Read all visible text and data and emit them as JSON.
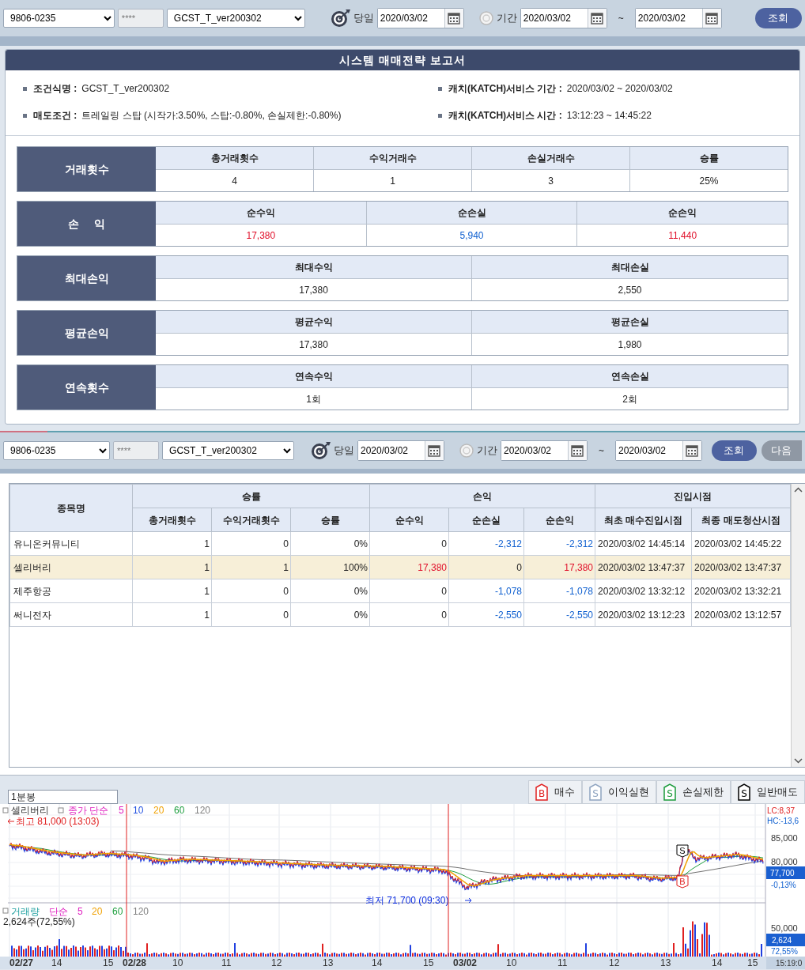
{
  "toolbars": [
    {
      "account": "9806-0235",
      "password": "****",
      "strategy": "GCST_T_ver200302",
      "modes": [
        {
          "label": "당일",
          "selected": true
        },
        {
          "label": "기간",
          "selected": false
        }
      ],
      "today_date": "2020/03/02",
      "period_from": "2020/03/02",
      "range_sep": "~",
      "period_to": "2020/03/02",
      "search_button": "조회"
    },
    {
      "account": "9806-0235",
      "password": "****",
      "strategy": "GCST_T_ver200302",
      "modes": [
        {
          "label": "당일",
          "selected": true
        },
        {
          "label": "기간",
          "selected": false
        }
      ],
      "today_date": "2020/03/02",
      "period_from": "2020/03/02",
      "range_sep": "~",
      "period_to": "2020/03/02",
      "search_button": "조회",
      "next_button": {
        "label": "다음",
        "disabled": true
      }
    }
  ],
  "report": {
    "title": "시스템 매매전략 보고서",
    "info": [
      {
        "label": "조건식명 :",
        "value": "GCST_T_ver200302"
      },
      {
        "label": "캐치(KATCH)서비스 기간 :",
        "value": "2020/03/02 ~ 2020/03/02"
      },
      {
        "label": "매도조건 :",
        "value": "트레일링 스탑 (시작가:3.50%, 스탑:-0.80%, 손실제한:-0.80%)"
      },
      {
        "label": "캐치(KATCH)서비스 시간 :",
        "value": "13:12:23 ~ 14:45:22"
      }
    ],
    "groups": [
      {
        "label": "거래횟수",
        "columns": [
          {
            "header": "총거래횟수",
            "value": "4",
            "color": "#222222"
          },
          {
            "header": "수익거래수",
            "value": "1",
            "color": "#222222"
          },
          {
            "header": "손실거래수",
            "value": "3",
            "color": "#222222"
          },
          {
            "header": "승률",
            "value": "25%",
            "color": "#222222"
          }
        ]
      },
      {
        "label": "손     익",
        "columns": [
          {
            "header": "순수익",
            "value": "17,380",
            "color": "#e0102a"
          },
          {
            "header": "순손실",
            "value": "5,940",
            "color": "#1060d0"
          },
          {
            "header": "순손익",
            "value": "11,440",
            "color": "#e0102a"
          }
        ]
      },
      {
        "label": "최대손익",
        "columns": [
          {
            "header": "최대수익",
            "value": "17,380",
            "color": "#222222"
          },
          {
            "header": "최대손실",
            "value": "2,550",
            "color": "#222222"
          }
        ]
      },
      {
        "label": "평균손익",
        "columns": [
          {
            "header": "평균수익",
            "value": "17,380",
            "color": "#222222"
          },
          {
            "header": "평균손실",
            "value": "1,980",
            "color": "#222222"
          }
        ]
      },
      {
        "label": "연속횟수",
        "columns": [
          {
            "header": "연속수익",
            "value": "1회",
            "color": "#222222"
          },
          {
            "header": "연속손실",
            "value": "2회",
            "color": "#222222"
          }
        ]
      }
    ]
  },
  "table": {
    "name_column": "종목명",
    "groups": [
      {
        "label": "승률",
        "columns": [
          "총거래횟수",
          "수익거래횟수",
          "승률"
        ]
      },
      {
        "label": "손익",
        "columns": [
          "순수익",
          "순손실",
          "순손익"
        ]
      },
      {
        "label": "진입시점",
        "columns": [
          "최초 매수진입시점",
          "최종 매도청산시점"
        ]
      }
    ],
    "rows": [
      {
        "name": "유니온커뮤니티",
        "selected": false,
        "cells": [
          {
            "text": "1"
          },
          {
            "text": "0"
          },
          {
            "text": "0%"
          },
          {
            "text": "0"
          },
          {
            "text": "-2,312",
            "color": "#1060d0"
          },
          {
            "text": "-2,312",
            "color": "#1060d0"
          },
          {
            "text": "2020/03/02 14:45:14"
          },
          {
            "text": "2020/03/02 14:45:22"
          }
        ]
      },
      {
        "name": "셀리버리",
        "selected": true,
        "cells": [
          {
            "text": "1"
          },
          {
            "text": "1"
          },
          {
            "text": "100%"
          },
          {
            "text": "17,380",
            "color": "#e0102a"
          },
          {
            "text": "0"
          },
          {
            "text": "17,380",
            "color": "#e0102a"
          },
          {
            "text": "2020/03/02 13:47:37"
          },
          {
            "text": "2020/03/02 13:47:37"
          }
        ]
      },
      {
        "name": "제주항공",
        "selected": false,
        "cells": [
          {
            "text": "1"
          },
          {
            "text": "0"
          },
          {
            "text": "0%"
          },
          {
            "text": "0"
          },
          {
            "text": "-1,078",
            "color": "#1060d0"
          },
          {
            "text": "-1,078",
            "color": "#1060d0"
          },
          {
            "text": "2020/03/02 13:32:12"
          },
          {
            "text": "2020/03/02 13:32:21"
          }
        ]
      },
      {
        "name": "써니전자",
        "selected": false,
        "cells": [
          {
            "text": "1"
          },
          {
            "text": "0"
          },
          {
            "text": "0%"
          },
          {
            "text": "0"
          },
          {
            "text": "-2,550",
            "color": "#1060d0"
          },
          {
            "text": "-2,550",
            "color": "#1060d0"
          },
          {
            "text": "2020/03/02 13:12:23"
          },
          {
            "text": "2020/03/02 13:12:57"
          }
        ]
      }
    ]
  },
  "chart": {
    "timeframe": "1분봉",
    "legend": [
      {
        "letter": "B",
        "label": "매수",
        "color": "#e02020"
      },
      {
        "letter": "S",
        "label": "이익실현",
        "color": "#8fa4c0"
      },
      {
        "letter": "S",
        "label": "손실제한",
        "color": "#1a9a3a"
      },
      {
        "letter": "S",
        "label": "일반매도",
        "color": "#000000"
      }
    ],
    "symbol": "셀리버리",
    "price_series": "종가 단순",
    "price_periods": [
      {
        "text": "5",
        "color": "#e020c0"
      },
      {
        "text": "10",
        "color": "#2050e0"
      },
      {
        "text": "20",
        "color": "#f0a000"
      },
      {
        "text": "60",
        "color": "#20a040"
      },
      {
        "text": "120",
        "color": "#808080"
      }
    ],
    "high_note": "최고 81,000 (13:03)",
    "low_note": "최저 71,700 (09:30)",
    "lc": "LC:8,37",
    "hc": "HC:-13,6",
    "price_ticks": [
      "85,000",
      "80,000"
    ],
    "current_price": "77,700",
    "change": "-0,13%",
    "markers": [
      {
        "letter": "S",
        "kind": "sell"
      },
      {
        "letter": "B",
        "kind": "buy"
      }
    ],
    "volume_label": "거래량",
    "volume_series": "단순",
    "volume_periods": [
      {
        "text": "5",
        "color": "#e020c0"
      },
      {
        "text": "20",
        "color": "#f0a000"
      },
      {
        "text": "60",
        "color": "#20a040"
      },
      {
        "text": "120",
        "color": "#808080"
      }
    ],
    "volume_note": "2,624주(72,55%)",
    "volume_tick": "50,000",
    "current_volume": "2,624",
    "volume_ratio": "72,55%",
    "time_axis": [
      {
        "text": "02/27",
        "kind": "date"
      },
      {
        "text": "14",
        "kind": "hour"
      },
      {
        "text": "15",
        "kind": "hour"
      },
      {
        "text": "02/28",
        "kind": "date"
      },
      {
        "text": "10",
        "kind": "hour"
      },
      {
        "text": "11",
        "kind": "hour"
      },
      {
        "text": "12",
        "kind": "hour"
      },
      {
        "text": "13",
        "kind": "hour"
      },
      {
        "text": "14",
        "kind": "hour"
      },
      {
        "text": "15",
        "kind": "hour"
      },
      {
        "text": "03/02",
        "kind": "date"
      },
      {
        "text": "10",
        "kind": "hour"
      },
      {
        "text": "11",
        "kind": "hour"
      },
      {
        "text": "12",
        "kind": "hour"
      },
      {
        "text": "13",
        "kind": "hour"
      },
      {
        "text": "14",
        "kind": "hour"
      },
      {
        "text": "15",
        "kind": "hour"
      }
    ],
    "cursor_time": "15:19:0"
  }
}
